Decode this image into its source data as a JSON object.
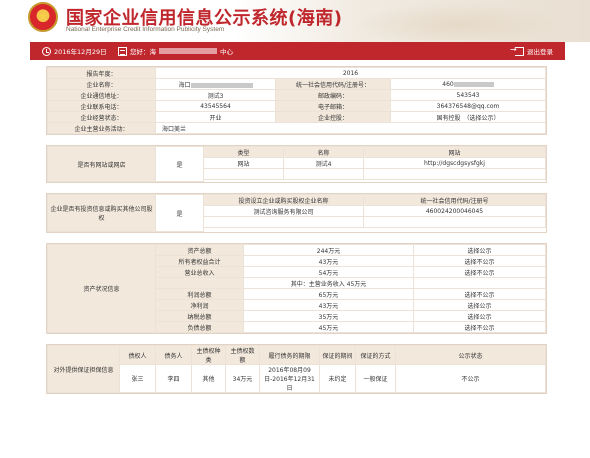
{
  "header": {
    "title_cn": "国家企业信用信息公示系统(海南)",
    "title_en": "National Enterprise Credit Information Publicity System",
    "emblem_glyph": "★"
  },
  "topbar": {
    "date": "2016年12月29日",
    "current_prefix": "您好：海",
    "current_suffix": "中心",
    "logout": "退出登录"
  },
  "basic": {
    "rows": [
      {
        "l1": "报告年度：",
        "v1": "2016"
      },
      {
        "l1": "企业名称：",
        "v1": "海口",
        "l2": "统一社会信用代码/注册号：",
        "v2": "460"
      },
      {
        "l1": "企业通信地址：",
        "v1": "测试3",
        "l2": "邮政编码：",
        "v2": "543543"
      },
      {
        "l1": "企业联系电话：",
        "v1": "43545564",
        "l2": "电子邮箱：",
        "v2": "364376548@qq.com"
      },
      {
        "l1": "企业经营状态：",
        "v1": "开业",
        "l2": "企业控股：",
        "v2": "国有控股　（选择公示）"
      },
      {
        "l1": "企业主营业务活动：",
        "v1": "海口美兰"
      }
    ]
  },
  "website": {
    "label": "是否有网站或网店",
    "flag": "是",
    "headers": [
      "类型",
      "名称",
      "网站"
    ],
    "rows": [
      [
        "网站",
        "测试4",
        "http://dgscdgsysfgkj"
      ]
    ]
  },
  "equity": {
    "label": "企业是否有投资信息或购买其他公司股权",
    "flag": "是",
    "headers": [
      "投资设立企业或购买股权企业名称",
      "统一社会信用代码/注册号"
    ],
    "rows": [
      [
        "测试咨询服务有限公司",
        "460024200046045"
      ]
    ]
  },
  "assets": {
    "label": "资产状况信息",
    "rows": [
      {
        "name": "资产总额",
        "value": "244万元",
        "pub": "选择公示"
      },
      {
        "name": "所有者权益合计",
        "value": "43万元",
        "pub": "选择不公示"
      },
      {
        "name": "营业总收入",
        "value": "54万元",
        "pub": "选择不公示"
      },
      {
        "name": "",
        "value": "其中：主营业务收入 45万元",
        "pub": ""
      },
      {
        "name": "利润总额",
        "value": "65万元",
        "pub": "选择不公示"
      },
      {
        "name": "净利润",
        "value": "43万元",
        "pub": "选择公示"
      },
      {
        "name": "纳税总额",
        "value": "35万元",
        "pub": "选择公示"
      },
      {
        "name": "负债总额",
        "value": "45万元",
        "pub": "选择不公示"
      }
    ]
  },
  "guarantee": {
    "label": "对外提供保证担保信息",
    "headers": [
      "债权人",
      "债务人",
      "主债权种类",
      "主债权数额",
      "履行债务的期限",
      "保证的期间",
      "保证的方式",
      "公示状态"
    ],
    "row": [
      "张三",
      "李四",
      "其他",
      "34万元",
      "2016年08月09日-2016年12月31日",
      "未约定",
      "一般保证",
      "不公示"
    ]
  }
}
